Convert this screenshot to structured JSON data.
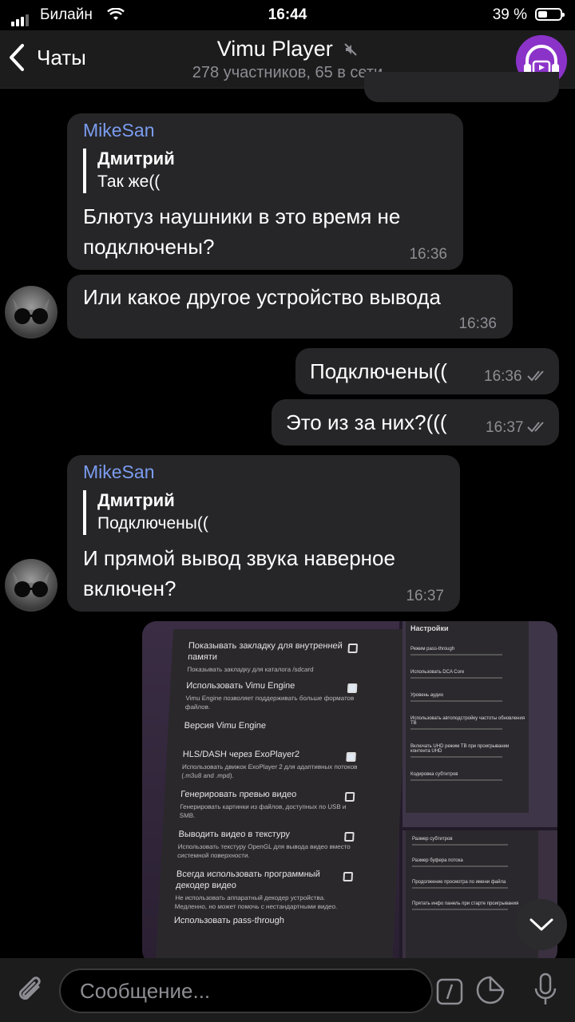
{
  "status": {
    "carrier": "Билайн",
    "time": "16:44",
    "battery": "39 %"
  },
  "header": {
    "back_label": "Чаты",
    "title": "Vimu Player",
    "subtitle": "278 участников, 65 в сети"
  },
  "messages": [
    {
      "sender": "MikeSan",
      "reply_name": "Дмитрий",
      "reply_text": "Так же((",
      "line1": "Блютуз наушники в это время не",
      "line2": "подключены?",
      "time": "16:36"
    },
    {
      "text": "Или какое другое устройство вывода",
      "time": "16:36"
    },
    {
      "text": "Подключены((",
      "time": "16:36"
    },
    {
      "text": "Это из за них?(((",
      "time": "16:37"
    },
    {
      "sender": "MikeSan",
      "reply_name": "Дмитрий",
      "reply_text": "Подключены((",
      "line1": "И прямой вывод звука наверное",
      "line2": "включен?",
      "time": "16:37"
    }
  ],
  "photo": {
    "left_panel": [
      {
        "title": "Показывать закладку для внутренней памяти",
        "desc": "Показывать закладку для каталога /sdcard",
        "checked": false
      },
      {
        "title": "Использовать Vimu Engine",
        "desc": "Vimu Engine позволяет поддерживать больше форматов файлов.",
        "checked": true
      },
      {
        "title": "Версия Vimu Engine",
        "desc": "",
        "checked": null
      },
      {
        "title": "HLS/DASH через ExoPlayer2",
        "desc": "Использовать движок ExoPlayer 2 для адаптивных потоков (.m3u8 and .mpd).",
        "checked": true
      },
      {
        "title": "Генерировать превью видео",
        "desc": "Генерировать картинки из файлов, доступных по USB и SMB.",
        "checked": false
      },
      {
        "title": "Выводить видео в текстуру",
        "desc": "Использовать текстуру OpenGL для вывода видео вместо системной поверхности.",
        "checked": false
      },
      {
        "title": "Всегда использовать программный декодер видео",
        "desc": "Не использовать аппаратный декодер устройства. Медленно, но может помочь с нестандартными видео.",
        "checked": false
      },
      {
        "title": "Использовать pass-through",
        "desc": "",
        "checked": null
      }
    ],
    "right_top_header": "Настройки",
    "right_top_items": [
      "Режим pass-through",
      "Использовать DCA Core",
      "Уровень аудио",
      "Использовать автоподстройку частоты обновления ТВ",
      "Включать UHD режим ТВ при проигрывании контента UHD",
      "Кодировка субтитров"
    ],
    "right_bottom_items": [
      "Размер субтитров",
      "Размер буфера потока",
      "Продолжение просмотра по имени файла",
      "Прятать инфо панель при старте проигрывания"
    ]
  },
  "input": {
    "placeholder": "Сообщение..."
  }
}
